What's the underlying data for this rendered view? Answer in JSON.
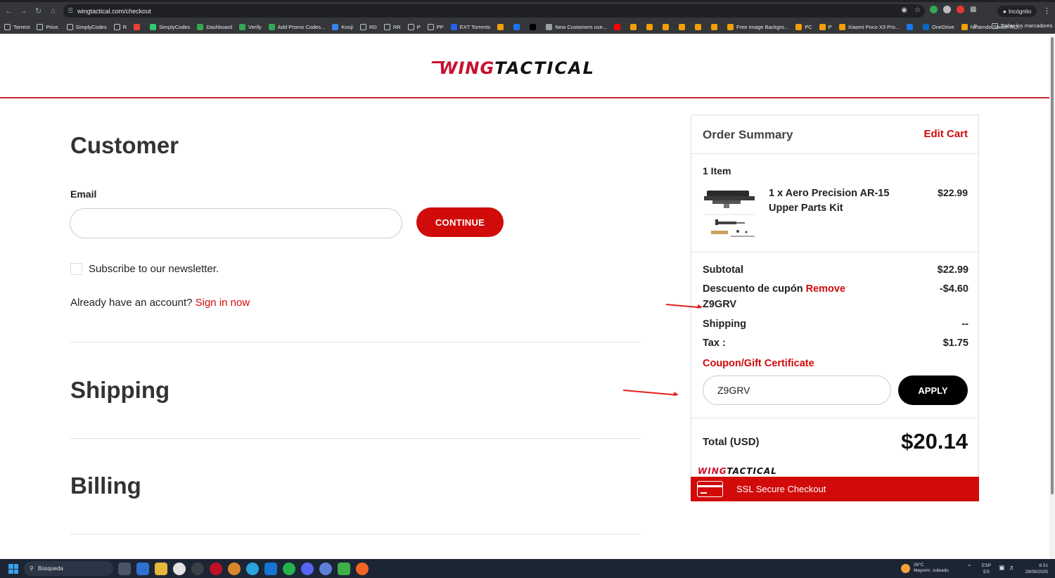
{
  "browser": {
    "url": "wingtactical.com/checkout",
    "incognito_label": "Incógnito",
    "bookmarks": [
      {
        "label": "Torrent",
        "icon": "folder-icon"
      },
      {
        "label": "Price.",
        "icon": "folder-icon"
      },
      {
        "label": "SimplyCodes",
        "icon": "folder-icon"
      },
      {
        "label": "R",
        "icon": "folder-icon"
      },
      {
        "label": "",
        "icon": "gmail-icon"
      },
      {
        "label": "SimplyCodes",
        "icon": "simplycodes-icon"
      },
      {
        "label": "Dashboard",
        "icon": "check-icon"
      },
      {
        "label": "Verify",
        "icon": "check-icon"
      },
      {
        "label": "Add Promo Codes...",
        "icon": "check-icon"
      },
      {
        "label": "Knoji",
        "icon": "knoji-icon"
      },
      {
        "label": "RD",
        "icon": "folder-icon"
      },
      {
        "label": "RR",
        "icon": "folder-icon"
      },
      {
        "label": "P",
        "icon": "folder-icon"
      },
      {
        "label": "PP",
        "icon": "folder-icon"
      },
      {
        "label": "EXT Torrents",
        "icon": "ext-icon"
      },
      {
        "label": "",
        "icon": "site-icon"
      },
      {
        "label": "",
        "icon": "facebook-icon"
      },
      {
        "label": "",
        "icon": "x-icon"
      },
      {
        "label": "New Customers use...",
        "icon": "globe-icon"
      },
      {
        "label": "",
        "icon": "youtube-icon"
      },
      {
        "label": "",
        "icon": "site-icon"
      },
      {
        "label": "",
        "icon": "site-icon"
      },
      {
        "label": "",
        "icon": "site-icon"
      },
      {
        "label": "",
        "icon": "site-icon"
      },
      {
        "label": "",
        "icon": "site-icon"
      },
      {
        "label": "",
        "icon": "site-icon"
      },
      {
        "label": "Free Image Backgro...",
        "icon": "site-icon"
      },
      {
        "label": "PC",
        "icon": "site-icon"
      },
      {
        "label": "P",
        "icon": "site-icon"
      },
      {
        "label": "Xiaomi Poco X3 Pro...",
        "icon": "site-icon"
      },
      {
        "label": "",
        "icon": "facebook-icon"
      },
      {
        "label": "OneDrive",
        "icon": "onedrive-icon"
      },
      {
        "label": "Nintendo Switch RO...",
        "icon": "site-icon"
      }
    ],
    "all_bookmarks_label": "Todos los marcadores"
  },
  "header": {
    "logo_wing": "WING",
    "logo_tactical": "TACTICAL"
  },
  "checkout": {
    "customer_title": "Customer",
    "email_label": "Email",
    "email_value": "",
    "continue_label": "CONTINUE",
    "newsletter_label": "Subscribe to our newsletter.",
    "account_text": "Already have an account?",
    "signin_label": "Sign in now",
    "shipping_title": "Shipping",
    "billing_title": "Billing"
  },
  "summary": {
    "title": "Order Summary",
    "edit_cart": "Edit Cart",
    "items_count": "1 Item",
    "item_name": "1 x Aero Precision AR-15 Upper Parts Kit",
    "item_price": "$22.99",
    "subtotal_label": "Subtotal",
    "subtotal_value": "$22.99",
    "discount_label": "Descuento de cupón",
    "remove_label": "Remove",
    "discount_value": "-$4.60",
    "coupon_code": "Z9GRV",
    "shipping_label": "Shipping",
    "shipping_value": "--",
    "tax_label": "Tax :",
    "tax_value": "$1.75",
    "coupon_title": "Coupon/Gift Certificate",
    "coupon_input_value": "Z9GRV",
    "apply_label": "APPLY",
    "total_label": "Total (USD)",
    "total_value": "$20.14",
    "footer_logo_wing": "WING",
    "footer_logo_tactical": "TACTICAL",
    "ssl_label": "SSL Secure Checkout"
  },
  "taskbar": {
    "search_placeholder": "Búsqueda",
    "weather_temp": "26°C",
    "weather_desc": "Mayorm. soleado",
    "lang_1": "ESP",
    "lang_2": "ES",
    "time": "8:31",
    "date": "29/08/2025"
  },
  "colors": {
    "brand_red": "#d10a0a",
    "header_rule": "#c62828"
  }
}
